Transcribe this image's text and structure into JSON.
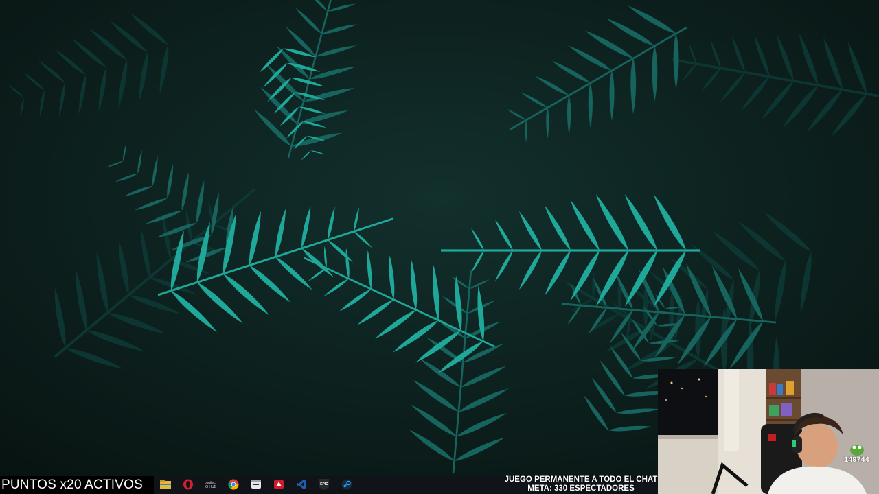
{
  "overlay": {
    "promo_text": "PUNTOS x20 ACTIVOS",
    "chat_line1": "JUEGO PERMANENTE A TODO EL CHAT",
    "chat_line2": "META: 330 ESPECTADORES",
    "webcam_counter": "149744"
  },
  "taskbar": {
    "icons": [
      {
        "name": "file-explorer-icon",
        "color": "#e8b63a"
      },
      {
        "name": "opera-gx-icon",
        "color": "#d4202a"
      },
      {
        "name": "logitech-icon",
        "label": "Logitech G HUB"
      },
      {
        "name": "chrome-icon"
      },
      {
        "name": "app-icon"
      },
      {
        "name": "red-app-icon",
        "color": "#d01c2a"
      },
      {
        "name": "visual-studio-icon",
        "color": "#1e5fb4"
      },
      {
        "name": "epic-games-icon",
        "label": "EPIC"
      },
      {
        "name": "steam-icon",
        "color": "#1a9fff"
      }
    ]
  },
  "colors": {
    "fern_bright": "#1fa89a",
    "fern_dim": "#0f4a46",
    "background": "#0b1816"
  }
}
